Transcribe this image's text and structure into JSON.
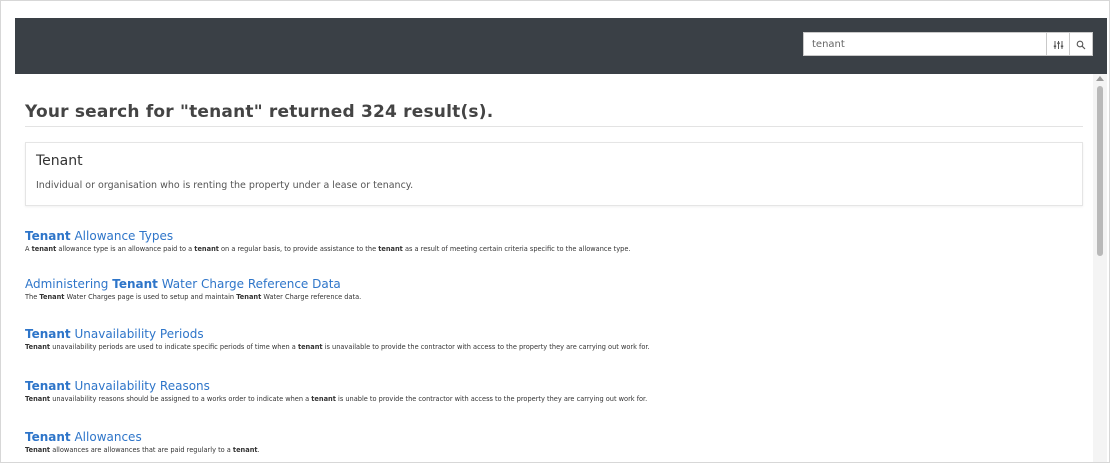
{
  "search": {
    "value": "tenant",
    "placeholder": "",
    "filter_icon": "sliders-icon",
    "search_icon": "magnifier-icon"
  },
  "heading": "Your search for \"tenant\" returned 324 result(s).",
  "definition": {
    "title": "Tenant",
    "description": "Individual or organisation who is renting the property under a lease or tenancy."
  },
  "results": [
    {
      "title_bold": "Tenant",
      "title_rest": " Allowance Types",
      "title_prefix": "",
      "desc": [
        {
          "t": "A "
        },
        {
          "b": "tenant"
        },
        {
          "t": " allowance type is an allowance paid to a "
        },
        {
          "b": "tenant"
        },
        {
          "t": " on a regular basis, to provide assistance to the "
        },
        {
          "b": "tenant"
        },
        {
          "t": " as a result of meeting certain criteria specific to the allowance type."
        }
      ]
    },
    {
      "title_prefix": "Administering ",
      "title_bold": "Tenant",
      "title_rest": " Water Charge Reference Data",
      "desc": [
        {
          "t": "The "
        },
        {
          "b": "Tenant"
        },
        {
          "t": " Water Charges page is used to setup and maintain "
        },
        {
          "b": "Tenant"
        },
        {
          "t": " Water Charge reference data."
        }
      ]
    },
    {
      "title_prefix": "",
      "title_bold": "Tenant",
      "title_rest": " Unavailability Periods",
      "desc": [
        {
          "b": "Tenant"
        },
        {
          "t": " unavailability periods are used to indicate specific periods of time when a "
        },
        {
          "b": "tenant"
        },
        {
          "t": " is unavailable to provide the contractor with access to the property they are carrying out work for."
        }
      ]
    },
    {
      "title_prefix": "",
      "title_bold": "Tenant",
      "title_rest": " Unavailability Reasons",
      "desc": [
        {
          "b": "Tenant"
        },
        {
          "t": " unavailability reasons should be assigned to a works order to indicate when a "
        },
        {
          "b": "tenant"
        },
        {
          "t": " is unable to provide the contractor with access to the property they are carrying out work for."
        }
      ]
    },
    {
      "title_prefix": "",
      "title_bold": "Tenant",
      "title_rest": " Allowances",
      "desc": [
        {
          "b": "Tenant"
        },
        {
          "t": " allowances are allowances that are paid regularly to a "
        },
        {
          "b": "tenant"
        },
        {
          "t": "."
        }
      ]
    }
  ],
  "colors": {
    "topbar": "#3a4046",
    "link": "#2e75c9",
    "heading": "#444444"
  }
}
